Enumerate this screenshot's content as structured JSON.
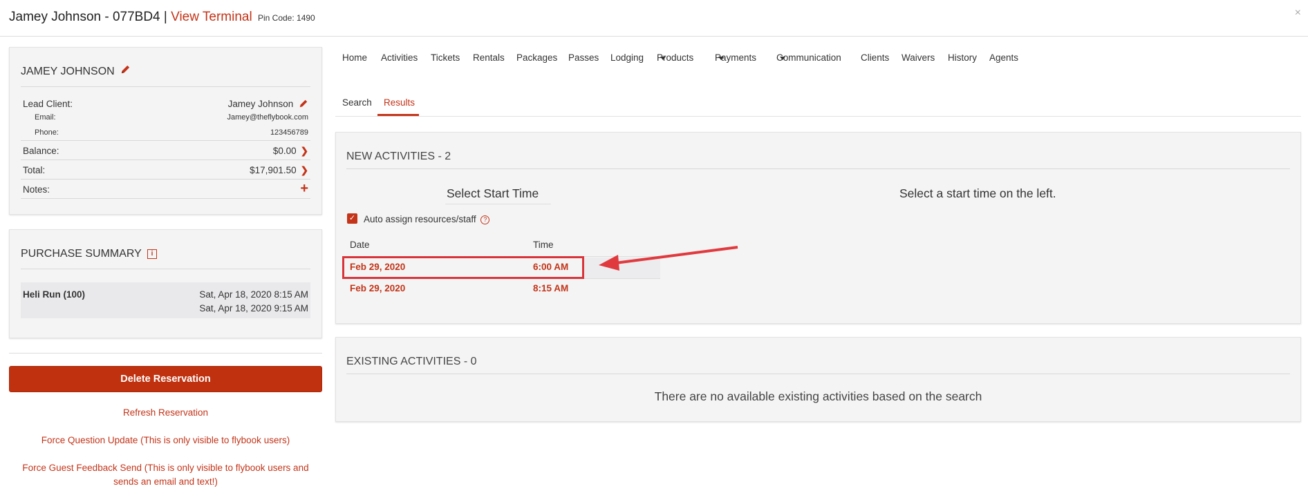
{
  "header": {
    "name_code": "Jamey Johnson - 077BD4",
    "separator": "|",
    "view_terminal": "View Terminal",
    "pin_code": "Pin Code: 1490",
    "close": "×"
  },
  "client": {
    "title": "JAMEY JOHNSON",
    "lead_label": "Lead Client:",
    "lead_value": "Jamey Johnson",
    "email_label": "Email:",
    "email_value": "Jamey@theflybook.com",
    "phone_label": "Phone:",
    "phone_value": "123456789",
    "balance_label": "Balance:",
    "balance_value": "$0.00",
    "total_label": "Total:",
    "total_value": "$17,901.50",
    "notes_label": "Notes:",
    "plus": "+"
  },
  "purchase": {
    "title": "PURCHASE SUMMARY",
    "info": "i",
    "item_name": "Heli Run (100)",
    "item_time_1": "Sat, Apr 18, 2020 8:15 AM",
    "item_time_2": "Sat, Apr 18, 2020 9:15 AM"
  },
  "actions": {
    "delete": "Delete Reservation",
    "refresh": "Refresh Reservation",
    "force_question": "Force Question Update (This is only visible to flybook users)",
    "force_feedback_1": "Force Guest Feedback Send (This is only visible to flybook users and",
    "force_feedback_2": "sends an email and text!)"
  },
  "nav": [
    "Home",
    "Activities",
    "Tickets",
    "Rentals",
    "Packages",
    "Passes",
    "Lodging",
    "Products",
    "Payments",
    "Communication",
    "Clients",
    "Waivers",
    "History",
    "Agents"
  ],
  "tabs": [
    "Search",
    "Results"
  ],
  "new_activities": {
    "title": "NEW ACTIVITIES - 2",
    "select_start": "Select Start Time",
    "select_left": "Select a start time on the left.",
    "auto_assign": "Auto assign resources/staff",
    "q": "?",
    "col_date": "Date",
    "col_time": "Time",
    "rows": [
      {
        "date": "Feb 29, 2020",
        "time": "6:00 AM"
      },
      {
        "date": "Feb 29, 2020",
        "time": "8:15 AM"
      }
    ]
  },
  "existing": {
    "title": "EXISTING ACTIVITIES - 0",
    "message": "There are no available existing activities based on the search"
  },
  "colors": {
    "accent": "#c33419",
    "highlight": "#d9343a"
  }
}
